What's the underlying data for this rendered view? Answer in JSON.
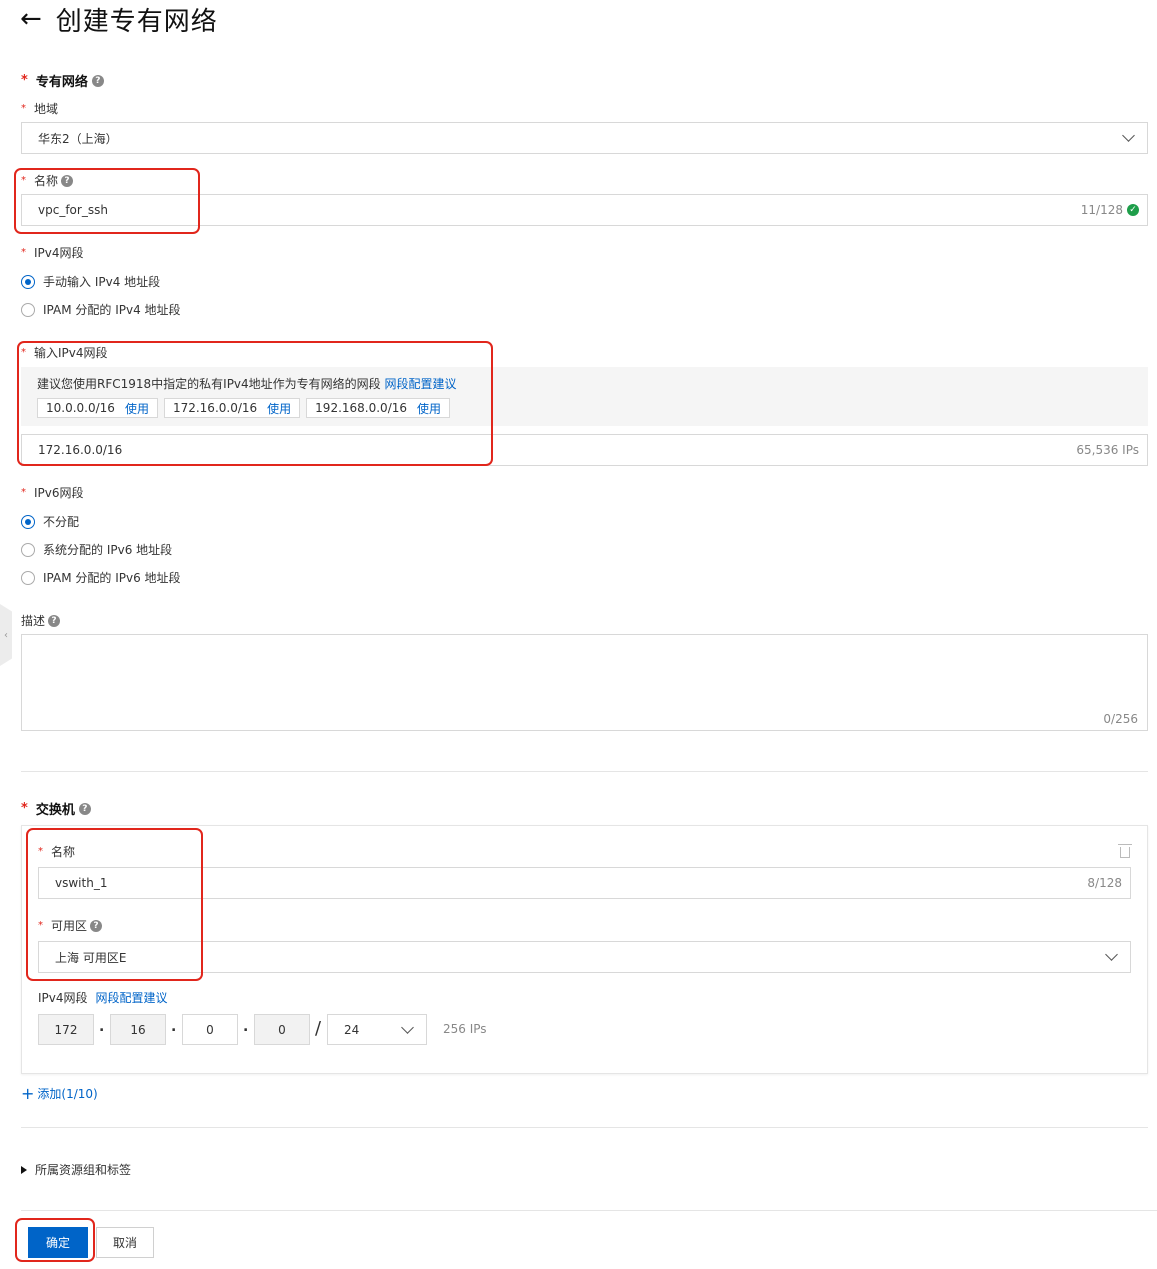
{
  "header": {
    "back_icon": "arrow-left-icon",
    "title": "创建专有网络"
  },
  "vpc": {
    "section_title": "专有网络",
    "region": {
      "label": "地域",
      "value": "华东2（上海）"
    },
    "name": {
      "label": "名称",
      "value": "vpc_for_ssh",
      "count": "11/128"
    },
    "ipv4": {
      "label": "IPv4网段",
      "options": [
        "手动输入 IPv4 地址段",
        "IPAM 分配的 IPv4 地址段"
      ],
      "selected": 0
    },
    "ipv4_input": {
      "label": "输入IPv4网段",
      "tip": "建议您使用RFC1918中指定的私有IPv4地址作为专有网络的网段",
      "tip_link": "网段配置建议",
      "suggestions": [
        "10.0.0.0/16",
        "172.16.0.0/16",
        "192.168.0.0/16"
      ],
      "use_label": "使用",
      "value": "172.16.0.0/16",
      "ips": "65,536 IPs"
    },
    "ipv6": {
      "label": "IPv6网段",
      "options": [
        "不分配",
        "系统分配的 IPv6 地址段",
        "IPAM 分配的 IPv6 地址段"
      ],
      "selected": 0
    },
    "description": {
      "label": "描述",
      "count": "0/256"
    }
  },
  "vswitch": {
    "section_title": "交换机",
    "name": {
      "label": "名称",
      "value": "vswith_1",
      "count": "8/128"
    },
    "zone": {
      "label": "可用区",
      "value": "上海 可用区E"
    },
    "ipv4_label": "IPv4网段",
    "ipv4_link": "网段配置建议",
    "octets": [
      "172",
      "16",
      "0",
      "0"
    ],
    "mask": "24",
    "ips": "256 IPs",
    "add_label": "添加(1/10)"
  },
  "resource_group_label": "所属资源组和标签",
  "buttons": {
    "confirm": "确定",
    "cancel": "取消"
  },
  "colors": {
    "primary": "#0064c8",
    "required": "#e1261c",
    "highlight": "#e1261c"
  }
}
